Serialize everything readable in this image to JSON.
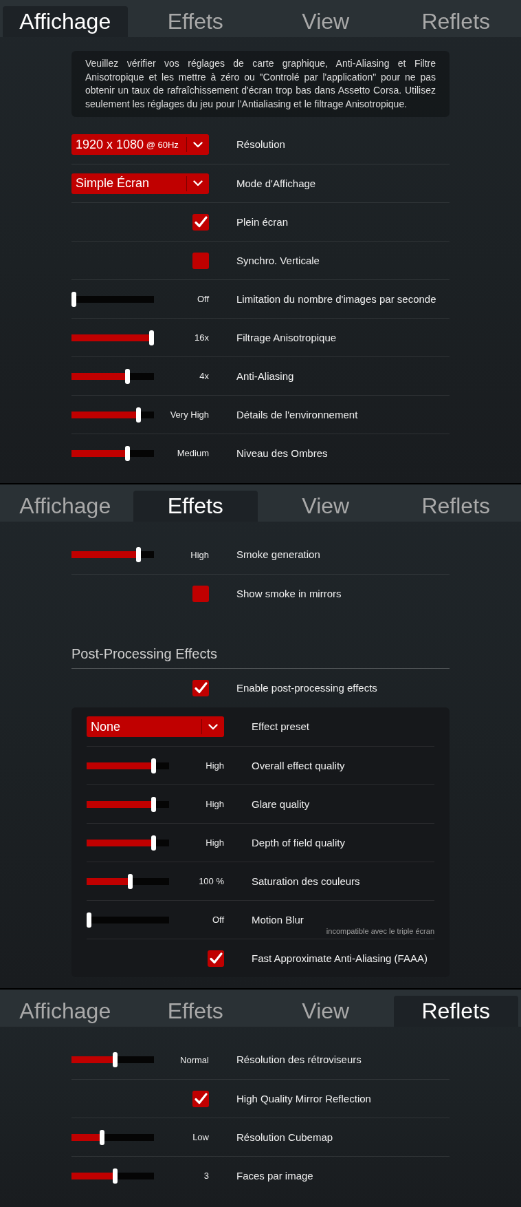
{
  "panels": [
    {
      "tabs": [
        {
          "label": "Affichage",
          "selected": true
        },
        {
          "label": "Effets",
          "selected": false
        },
        {
          "label": "View",
          "selected": false
        },
        {
          "label": "Reflets",
          "selected": false
        }
      ],
      "notice": "Veuillez vérifier vos réglages de carte graphique, Anti-Aliasing et Filtre Anisotropique et les mettre à zéro ou \"Controlé par l'application\" pour ne pas obtenir un taux de rafraîchissement d'écran trop bas dans Assetto Corsa. Utilisez seulement les réglages du jeu pour l'Antialiasing et le filtrage Anisotropique.",
      "rows": [
        {
          "kind": "dropdown",
          "value": "1920 x 1080",
          "detail": "@ 60Hz",
          "label": "Résolution"
        },
        {
          "kind": "dropdown",
          "value": "Simple Écran",
          "label": "Mode d'Affichage"
        },
        {
          "kind": "checkbox",
          "checked": true,
          "label": "Plein écran"
        },
        {
          "kind": "checkbox",
          "checked": false,
          "label": "Synchro. Verticale"
        },
        {
          "kind": "slider",
          "level": 0,
          "reading": "Off",
          "label": "Limitation du nombre d'images par seconde"
        },
        {
          "kind": "slider",
          "level": 1,
          "reading": "16x",
          "label": "Filtrage Anisotropique"
        },
        {
          "kind": "slider",
          "level": 0.69,
          "reading": "4x",
          "label": "Anti-Aliasing"
        },
        {
          "kind": "slider",
          "level": 0.83,
          "reading": "Very High",
          "label": "Détails de l'environnement"
        },
        {
          "kind": "slider",
          "level": 0.69,
          "reading": "Medium",
          "label": "Niveau des Ombres"
        }
      ]
    },
    {
      "tabs": [
        {
          "label": "Affichage",
          "selected": false
        },
        {
          "label": "Effets",
          "selected": true
        },
        {
          "label": "View",
          "selected": false
        },
        {
          "label": "Reflets",
          "selected": false
        }
      ],
      "rows": [
        {
          "kind": "slider",
          "level": 0.83,
          "reading": "High",
          "label": "Smoke generation"
        },
        {
          "kind": "checkbox",
          "checked": false,
          "label": "Show smoke in mirrors"
        },
        {
          "kind": "heading",
          "title": "Post-Processing Effects"
        },
        {
          "kind": "checkbox",
          "checked": true,
          "label": "Enable post-processing effects"
        },
        {
          "kind": "group",
          "rows": [
            {
              "kind": "dropdown",
              "value": "None",
              "label": "Effect preset"
            },
            {
              "kind": "slider",
              "level": 0.83,
              "reading": "High",
              "label": "Overall effect quality"
            },
            {
              "kind": "slider",
              "level": 0.83,
              "reading": "High",
              "label": "Glare quality"
            },
            {
              "kind": "slider",
              "level": 0.83,
              "reading": "High",
              "label": "Depth of field quality"
            },
            {
              "kind": "slider",
              "level": 0.53,
              "reading": "100 %",
              "label": "Saturation des couleurs"
            },
            {
              "kind": "slider",
              "level": 0,
              "reading": "Off",
              "label": "Motion Blur",
              "note": "incompatible avec le triple écran"
            },
            {
              "kind": "checkbox",
              "checked": true,
              "label": "Fast Approximate Anti-Aliasing (FAAA)"
            }
          ]
        }
      ]
    },
    {
      "tabs": [
        {
          "label": "Affichage",
          "selected": false
        },
        {
          "label": "Effets",
          "selected": false
        },
        {
          "label": "View",
          "selected": false
        },
        {
          "label": "Reflets",
          "selected": true
        }
      ],
      "rows": [
        {
          "kind": "slider",
          "level": 0.53,
          "reading": "Normal",
          "label": "Résolution des rétroviseurs"
        },
        {
          "kind": "checkbox",
          "checked": true,
          "label": "High Quality Mirror Reflection"
        },
        {
          "kind": "slider",
          "level": 0.36,
          "reading": "Low",
          "label": "Résolution Cubemap"
        },
        {
          "kind": "slider",
          "level": 0.53,
          "reading": "3",
          "label": "Faces par image"
        }
      ]
    }
  ]
}
